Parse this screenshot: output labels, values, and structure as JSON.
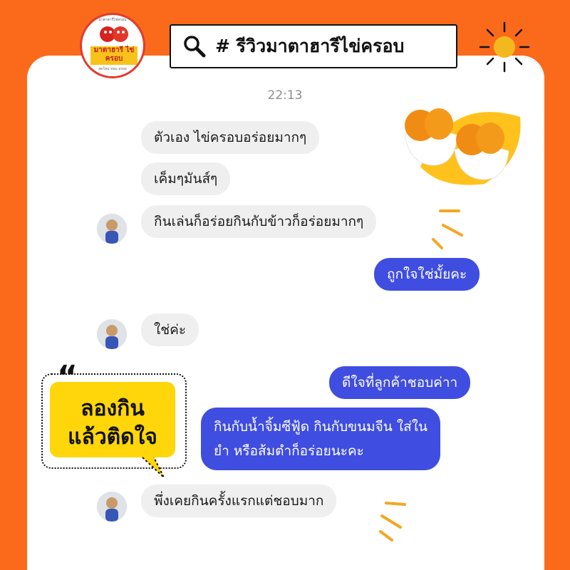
{
  "logo": {
    "top_text": "มาตาฮารีไข่ครอบ",
    "title": "มาตาฮารี ไข่ครอบ",
    "subtitle": "สดใหม่ หอม อร่อย"
  },
  "search": {
    "text": "# รีวิวมาตาฮารีไข่ครอบ"
  },
  "chat": {
    "timestamp": "22:13",
    "messages": [
      {
        "side": "left",
        "text": "ตัวเอง ไข่ครอบอร่อยมากๆ"
      },
      {
        "side": "left",
        "text": "เค็มๆมันส์ๆ"
      },
      {
        "side": "left",
        "text": "กินเล่นก็อร่อยกินกับข้าวก็อร่อยมากๆ"
      },
      {
        "side": "right",
        "text": "ถูกใจใช่มั้ยคะ"
      },
      {
        "side": "left",
        "text": "ใช่ค่ะ"
      },
      {
        "side": "right",
        "text": "ดีใจที่ลูกค้าชอบค่าา"
      },
      {
        "side": "right",
        "text": "กินกับน้ำจิ้มซีฟู้ด กินกับขนมจีน ใส่ใน"
      },
      {
        "side": "right",
        "text": "ยำ หรือส้มตำก็อร่อยนะคะ"
      },
      {
        "side": "left",
        "text": "พึ่งเคยกินครั้งแรกแต่ชอบมาก"
      }
    ]
  },
  "badge": {
    "quote_mark": "“",
    "line1": "ลองกิน",
    "line2": "แล้วติดใจ"
  },
  "colors": {
    "background": "#fb6a1a",
    "card": "#ffffff",
    "bubble_left": "#efefef",
    "bubble_right": "#3f4de0",
    "badge": "#ffd60a",
    "accent": "#f5a623"
  }
}
